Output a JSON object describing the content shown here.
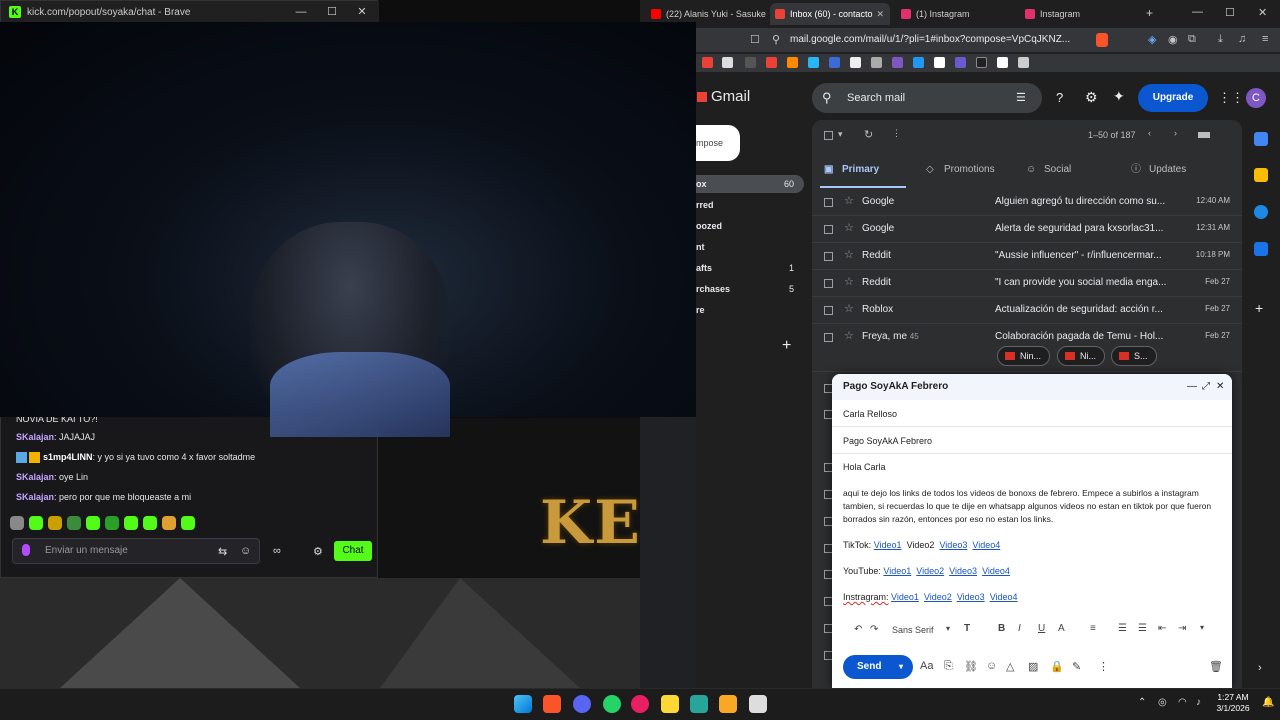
{
  "kick": {
    "title": "kick.com/popout/soyaka/chat - Brave",
    "minimize": "—",
    "maximize": "☐",
    "close": "✕",
    "chat": [
      {
        "user": "",
        "text": "NOVIA DE KAI TO?!"
      },
      {
        "user": "SKalajan",
        "text": ": JAJAJAJ"
      },
      {
        "user": "s1mp4LINN",
        "text": ": y yo si ya tuvo como 4 x favor soltadme"
      },
      {
        "user": "SKalajan",
        "text": ": oye Lin"
      },
      {
        "user": "SKalajan",
        "text": ": pero por que me bloqueaste a mi"
      }
    ],
    "input_placeholder": "Enviar un mensaje",
    "send_label": "Chat"
  },
  "stream": {
    "overlay_text": "KERN"
  },
  "browser": {
    "tabs": [
      {
        "label": "(22) Alanis Yuki - Sasuke",
        "color": "#ff0000"
      },
      {
        "label": "Inbox (60) - contacto",
        "color": "#ea4335"
      },
      {
        "label": "(1) Instagram",
        "color": "#e1306c"
      },
      {
        "label": "Instagram",
        "color": "#e1306c"
      }
    ],
    "new_tab": "+",
    "url": "mail.google.com/mail/u/1/?pli=1#inbox?compose=VpCqJKNZ..."
  },
  "gmail": {
    "brand": "Gmail",
    "search_placeholder": "Search mail",
    "upgrade": "Upgrade",
    "avatar_letter": "C",
    "compose": "mpose",
    "nav": [
      {
        "label": "ox",
        "count": "60"
      },
      {
        "label": "rred",
        "count": ""
      },
      {
        "label": "oozed",
        "count": ""
      },
      {
        "label": "nt",
        "count": ""
      },
      {
        "label": "afts",
        "count": "1"
      },
      {
        "label": "rchases",
        "count": "5"
      },
      {
        "label": "re",
        "count": ""
      }
    ],
    "pagination": "1–50 of 187",
    "tabs": [
      "Primary",
      "Promotions",
      "Social",
      "Updates"
    ],
    "rows": [
      {
        "from": "Google",
        "subject": "Alguien agregó tu dirección como su...",
        "date": "12:40 AM"
      },
      {
        "from": "Google",
        "subject": "Alerta de seguridad para kxsorlac31...",
        "date": "12:31 AM"
      },
      {
        "from": "Reddit",
        "subject": "\"Aussie influencer\" - r/influencermar...",
        "date": "10:18 PM"
      },
      {
        "from": "Reddit",
        "subject": "\"I can provide you social media enga...",
        "date": "Feb 27"
      },
      {
        "from": "Roblox",
        "subject": "Actualización de seguridad: acción r...",
        "date": "Feb 27"
      },
      {
        "from": "Freya, me",
        "count": "45",
        "subject": "Colaboración pagada de Temu - Hol...",
        "date": "Feb 27"
      }
    ],
    "chips": [
      "Nin...",
      "Ni...",
      "S..."
    ]
  },
  "compose": {
    "title": "Pago SoyAkA Febrero",
    "to": "Carla Relloso",
    "subject": "Pago SoyAkA Febrero",
    "greeting": "Hola Carla",
    "body": "aqui te dejo los links de todos los videos de bonoxs de febrero. Empece a subirlos a instagram tambien, si recuerdas lo que te dije en whatsapp algunos videos no estan en tiktok por que fueron borrados sin razón, entonces por eso no estan los links.",
    "tiktok_label": "TikTok:",
    "youtube_label": "YouTube:",
    "instagram_label": "Instragram:",
    "v1": "Video1",
    "v2": "Video2",
    "v3": "Video3",
    "v4": "Video4",
    "font": "Sans Serif",
    "send": "Send"
  },
  "taskbar": {
    "time": "1:27 AM",
    "date": "3/1/2026"
  }
}
